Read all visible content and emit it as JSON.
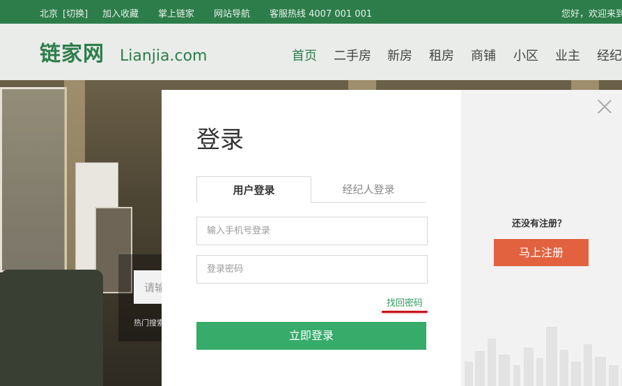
{
  "topbar": {
    "city": "北京",
    "switch_city": "[切换]",
    "favorite": "加入收藏",
    "mobile": "掌上链家",
    "site_nav": "网站导航",
    "hotline": "客服热线  4007 001 001",
    "greeting": "您好，欢迎来到"
  },
  "header": {
    "logo_cn": "链家网",
    "logo_en": "Lianjia.com",
    "nav": [
      "首页",
      "二手房",
      "新房",
      "租房",
      "商铺",
      "小区",
      "业主",
      "经纪人"
    ]
  },
  "hero": {
    "search_placeholder": "请输入",
    "hot_search": "热门搜索"
  },
  "modal": {
    "title": "登录",
    "tab_user": "用户登录",
    "tab_agent": "经纪人登录",
    "phone_placeholder": "输入手机号登录",
    "password_placeholder": "登录密码",
    "forgot_password": "找回密码",
    "login_button": "立即登录",
    "no_account": "还没有注册？",
    "register_button": "马上注册"
  },
  "colors": {
    "brand_green": "#2d7d4b",
    "login_green": "#36ab6a",
    "register_orange": "#e2613f",
    "annotation_red": "#c8141b"
  }
}
